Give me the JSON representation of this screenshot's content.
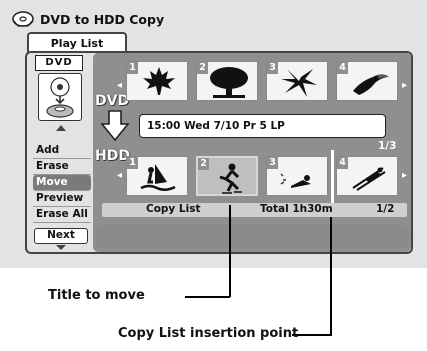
{
  "screen": {
    "title": "DVD to HDD Copy",
    "tab": "Play List",
    "dvd_badge": "DVD",
    "menu_items": [
      "Add",
      "Erase",
      "Move",
      "Preview",
      "Erase All"
    ],
    "selected_menu": "Move",
    "next_label": "Next",
    "dvd_label": "DVD",
    "hdd_label": "HDD",
    "info_text": "15:00 Wed  7/10  Pr 5   LP",
    "dvd_page": "1/3",
    "hdd_page": "1/2",
    "copy_list_label": "Copy List",
    "total_label": "Total  1h30m",
    "dvd_thumbs": [
      {
        "num": "1",
        "icon": "maple-leaf-icon"
      },
      {
        "num": "2",
        "icon": "tree-icon"
      },
      {
        "num": "3",
        "icon": "lily-flower-icon"
      },
      {
        "num": "4",
        "icon": "toucan-bird-icon"
      }
    ],
    "hdd_thumbs": [
      {
        "num": "1",
        "icon": "windsurfer-icon"
      },
      {
        "num": "2",
        "icon": "skater-icon",
        "selected": true
      },
      {
        "num": "3",
        "icon": "swimmer-icon"
      },
      {
        "num": "4",
        "icon": "ski-jumper-icon"
      }
    ]
  },
  "callouts": {
    "title_to_move": "Title to move",
    "insertion_point": "Copy List insertion point"
  },
  "colors": {
    "panel": "#8f8f8f",
    "frame": "#e3e3e3",
    "selected_menu": "#7a7a7a"
  }
}
